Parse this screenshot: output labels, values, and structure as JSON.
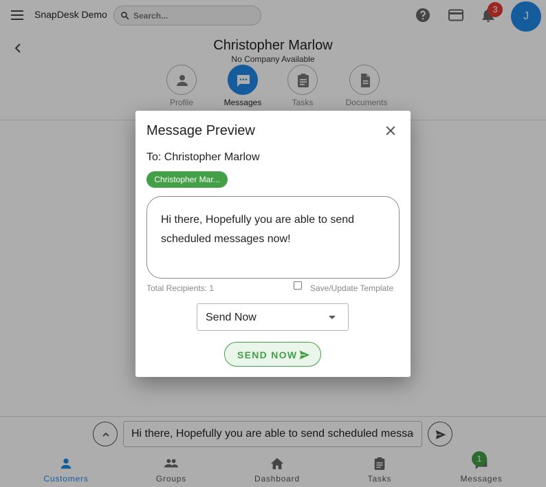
{
  "app": {
    "title": "SnapDesk Demo"
  },
  "search": {
    "placeholder": "Search..."
  },
  "header_icons": {
    "help": "help-icon",
    "billing": "credit-card-icon",
    "notifications": "bell-icon"
  },
  "notifications": {
    "count": "3"
  },
  "user": {
    "initial": "J"
  },
  "customer": {
    "name": "Christopher Marlow",
    "company": "No Company Available"
  },
  "tabs": [
    {
      "label": "Profile",
      "icon": "person-icon",
      "active": false
    },
    {
      "label": "Messages",
      "icon": "chat-icon",
      "active": true
    },
    {
      "label": "Tasks",
      "icon": "clipboard-icon",
      "active": false
    },
    {
      "label": "Documents",
      "icon": "document-icon",
      "active": false
    }
  ],
  "dialog": {
    "title": "Message Preview",
    "to": "To: Christopher Marlow",
    "chip": "Christopher Mar...",
    "message": "Hi there, Hopefully you are able to send scheduled messages now!",
    "recipients": "Total Recipients: 1",
    "template_label": "Save/Update Template",
    "template_checked": false,
    "send_option": "Send Now",
    "send_button": "SEND NOW"
  },
  "composer": {
    "value": "Hi there, Hopefully you are able to send scheduled messages now!"
  },
  "bottom_nav": {
    "items": [
      {
        "label": "Customers",
        "icon": "person-icon",
        "active": true
      },
      {
        "label": "Groups",
        "icon": "groups-icon",
        "active": false
      },
      {
        "label": "Dashboard",
        "icon": "home-icon",
        "active": false
      },
      {
        "label": "Tasks",
        "icon": "clipboard-icon",
        "active": false
      },
      {
        "label": "Messages",
        "icon": "chat-icon",
        "active": false
      }
    ],
    "messages_badge": "1"
  },
  "colors": {
    "primary": "#1e88e5",
    "success": "#43a047",
    "danger": "#e53935"
  }
}
